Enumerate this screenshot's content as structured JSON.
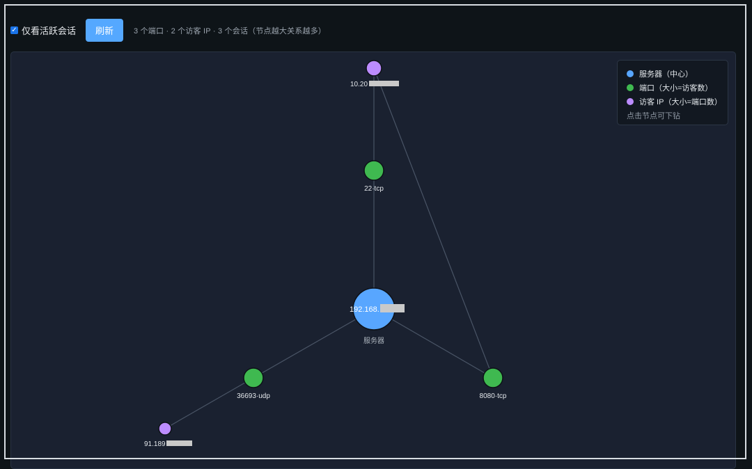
{
  "toolbar": {
    "active_only_label": "仅看活跃会话",
    "active_only_checked": true,
    "refresh_label": "刷新",
    "summary": "3 个端口 · 2 个访客 IP · 3 个会话（节点越大关系越多）"
  },
  "legend": {
    "items": [
      {
        "label": "服务器（中心）",
        "color": "#58a6ff"
      },
      {
        "label": "端口（大小=访客数）",
        "color": "#3fb950"
      },
      {
        "label": "访客 IP（大小=端口数）",
        "color": "#bc8cff"
      }
    ],
    "hint": "点击节点可下钻"
  },
  "graph": {
    "edge_color": "#4a5566",
    "nodes": [
      {
        "id": "server",
        "type": "server",
        "label": "192.168.",
        "redacted": true,
        "sublabel": "服务器",
        "color": "#58a6ff"
      },
      {
        "id": "p22",
        "type": "port",
        "label": "22·tcp",
        "color": "#3fb950"
      },
      {
        "id": "p36693",
        "type": "port",
        "label": "36693·udp",
        "color": "#3fb950"
      },
      {
        "id": "p8080",
        "type": "port",
        "label": "8080·tcp",
        "color": "#3fb950"
      },
      {
        "id": "v10",
        "type": "visitor",
        "label": "10.20",
        "redacted": true,
        "color": "#bc8cff"
      },
      {
        "id": "v91",
        "type": "visitor",
        "label": "91.189",
        "redacted": true,
        "color": "#bc8cff"
      }
    ],
    "edges": [
      {
        "from": "server",
        "to": "p22"
      },
      {
        "from": "server",
        "to": "p36693"
      },
      {
        "from": "server",
        "to": "p8080"
      },
      {
        "from": "p22",
        "to": "v10"
      },
      {
        "from": "p8080",
        "to": "v10"
      },
      {
        "from": "p36693",
        "to": "v91"
      }
    ]
  }
}
